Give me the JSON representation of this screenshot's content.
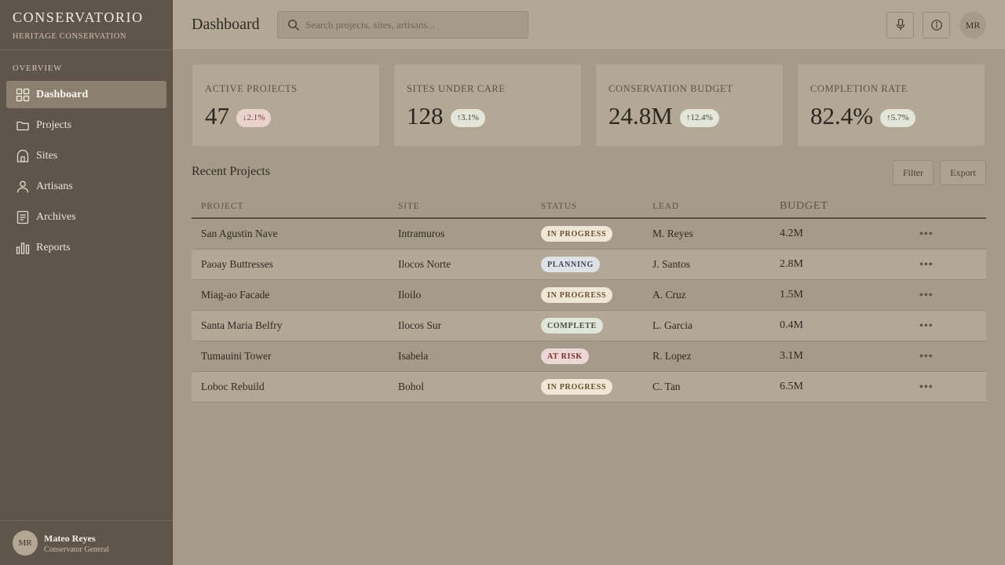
{
  "app": {
    "brand": "CONSERVATORIO",
    "brand_sub": "HERITAGE CONSERVATION"
  },
  "sidebar": {
    "section_label": "OVERVIEW",
    "items": [
      {
        "label": "Dashboard",
        "icon": "grid-icon",
        "active": true
      },
      {
        "label": "Projects",
        "icon": "folder-icon"
      },
      {
        "label": "Sites",
        "icon": "building-icon"
      },
      {
        "label": "Artisans",
        "icon": "person-icon"
      },
      {
        "label": "Archives",
        "icon": "document-icon"
      },
      {
        "label": "Reports",
        "icon": "bar-chart-icon"
      }
    ],
    "user": {
      "initials": "MR",
      "name": "Mateo Reyes",
      "role": "Conservator General"
    }
  },
  "header": {
    "title": "Dashboard",
    "search_placeholder": "Search projects, sites, artisans...",
    "avatar_initials": "MR"
  },
  "stats": [
    {
      "label": "ACTIVE PROJECTS",
      "value": "47",
      "delta": "2.1%",
      "direction": "down"
    },
    {
      "label": "SITES UNDER CARE",
      "value": "128",
      "delta": "3.1%",
      "direction": "up"
    },
    {
      "label": "CONSERVATION BUDGET",
      "value": "24.8M",
      "delta": "12.4%",
      "direction": "up"
    },
    {
      "label": "COMPLETION RATE",
      "value": "82.4%",
      "delta": "5.7%",
      "direction": "up"
    }
  ],
  "recent": {
    "title": "Recent Projects",
    "filter_label": "Filter",
    "export_label": "Export",
    "columns": [
      "PROJECT",
      "SITE",
      "STATUS",
      "LEAD",
      "BUDGET"
    ],
    "rows": [
      {
        "project": "San Agustin Nave",
        "site": "Intramuros",
        "status": "IN PROGRESS",
        "status_kind": "progress",
        "lead": "M. Reyes",
        "budget": "4.2M"
      },
      {
        "project": "Paoay Buttresses",
        "site": "Ilocos Norte",
        "status": "PLANNING",
        "status_kind": "planning",
        "lead": "J. Santos",
        "budget": "2.8M"
      },
      {
        "project": "Miag-ao Facade",
        "site": "Iloilo",
        "status": "IN PROGRESS",
        "status_kind": "progress",
        "lead": "A. Cruz",
        "budget": "1.5M"
      },
      {
        "project": "Santa Maria Belfry",
        "site": "Ilocos Sur",
        "status": "COMPLETE",
        "status_kind": "complete",
        "lead": "L. Garcia",
        "budget": "0.4M"
      },
      {
        "project": "Tumauini Tower",
        "site": "Isabela",
        "status": "AT RISK",
        "status_kind": "risk",
        "lead": "R. Lopez",
        "budget": "3.1M"
      },
      {
        "project": "Loboc Rebuild",
        "site": "Bohol",
        "status": "IN PROGRESS",
        "status_kind": "progress",
        "lead": "C. Tan",
        "budget": "6.5M"
      }
    ]
  },
  "colors": {
    "sidebar_bg": "#5f554a",
    "content_bg": "#a69b8b",
    "card_bg": "#b3a896",
    "badge_down": "#ead3cc",
    "badge_up": "#e3e5d8"
  }
}
